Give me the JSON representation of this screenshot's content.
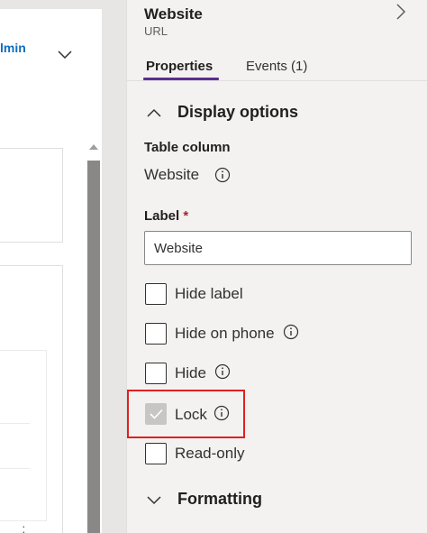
{
  "canvas": {
    "link_text": "lmin"
  },
  "panel": {
    "title": "Website",
    "subtitle": "URL",
    "tabs": [
      {
        "label": "Properties",
        "active": true
      },
      {
        "label": "Events (1)",
        "active": false
      }
    ],
    "display_options": {
      "header": "Display options",
      "expanded": true,
      "table_column_label": "Table column",
      "table_column_value": "Website",
      "label_field_label": "Label",
      "label_required_marker": "*",
      "label_value": "Website",
      "checkboxes": [
        {
          "label": "Hide label",
          "checked": false,
          "disabled": false
        },
        {
          "label": "Hide on phone",
          "checked": false,
          "disabled": false
        },
        {
          "label": "Hide",
          "checked": false,
          "disabled": false
        },
        {
          "label": "Lock",
          "checked": true,
          "disabled": true
        },
        {
          "label": "Read-only",
          "checked": false,
          "disabled": false
        }
      ]
    },
    "formatting": {
      "header": "Formatting",
      "expanded": false
    }
  },
  "colors": {
    "accent": "#5c2e91",
    "link": "#0f6cbd",
    "highlight": "#e02020",
    "required": "#a4262c"
  },
  "icons": [
    "chevron-down-icon",
    "chevron-right-icon",
    "chevron-up-icon",
    "info-icon",
    "checkmark-icon",
    "more-icon"
  ]
}
